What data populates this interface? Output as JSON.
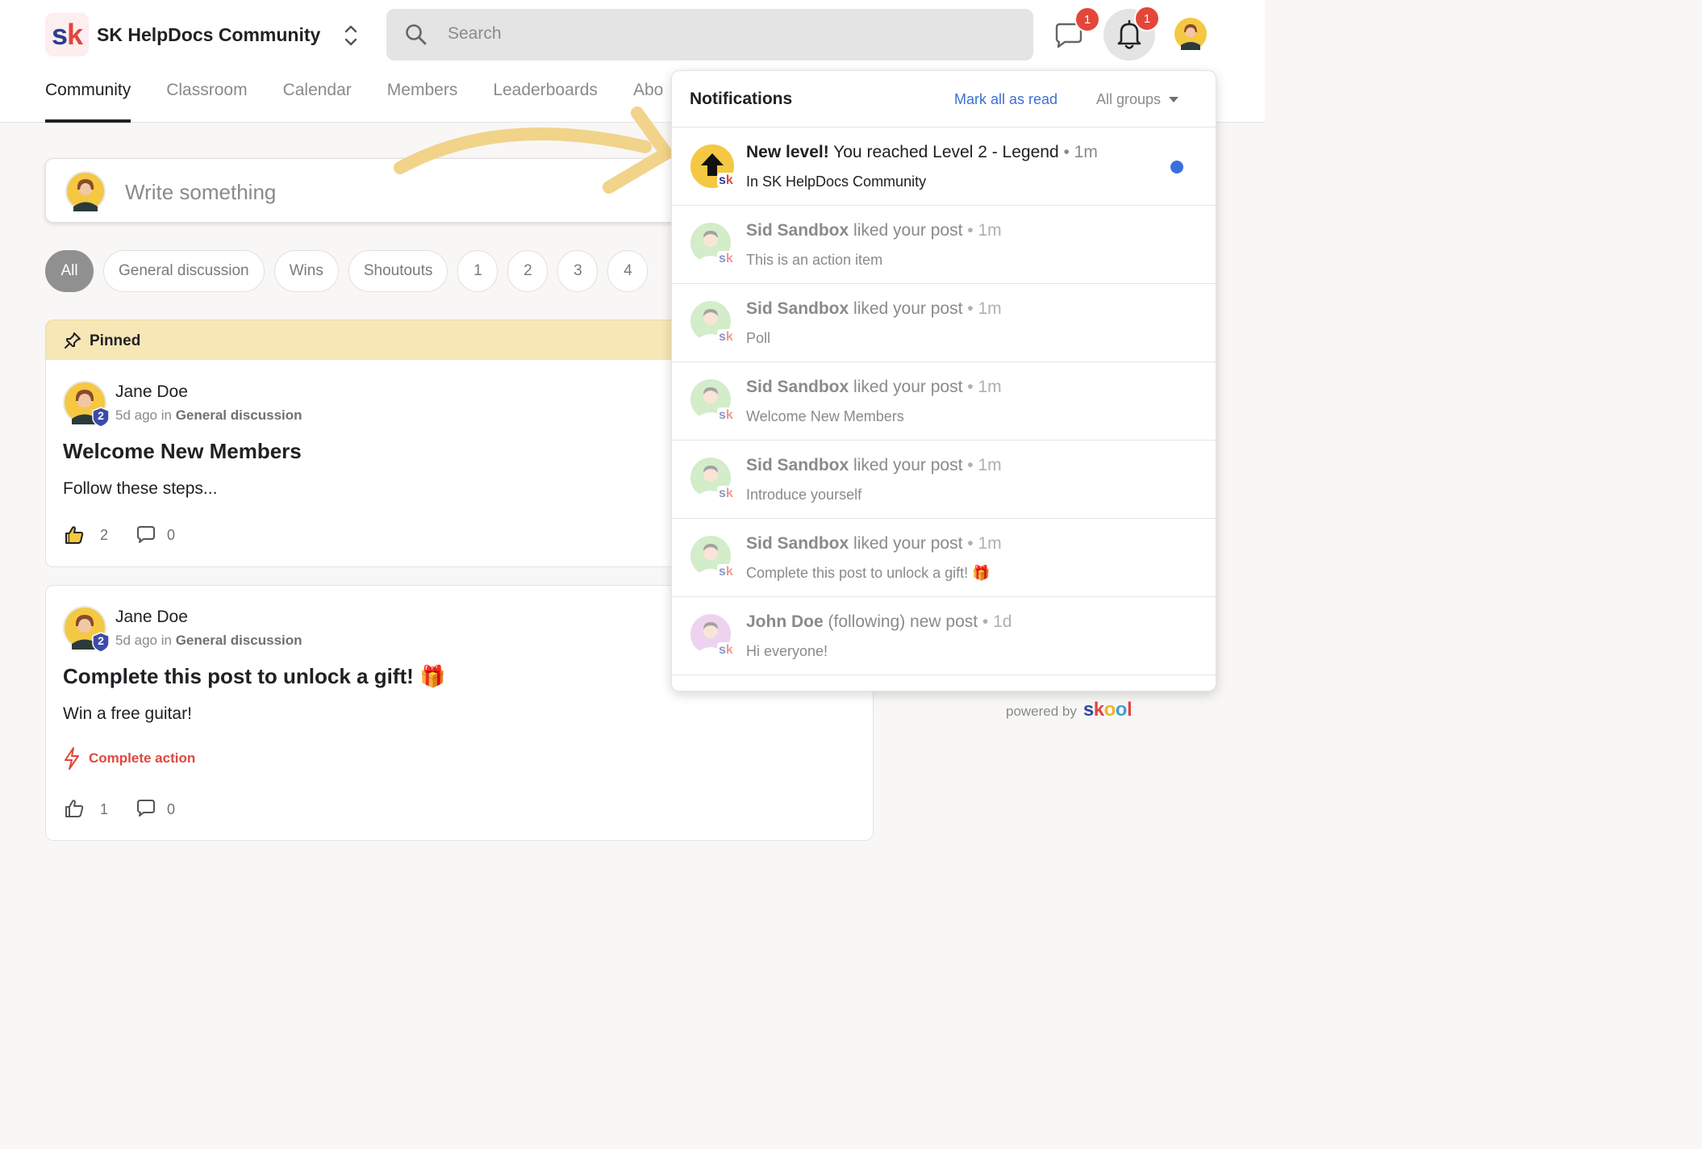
{
  "header": {
    "logo_text_s": "s",
    "logo_text_k": "k",
    "group_name": "SK HelpDocs Community",
    "search_placeholder": "Search",
    "chat_badge": "1",
    "bell_badge": "1"
  },
  "tabs": [
    {
      "label": "Community",
      "active": true
    },
    {
      "label": "Classroom"
    },
    {
      "label": "Calendar"
    },
    {
      "label": "Members"
    },
    {
      "label": "Leaderboards"
    },
    {
      "label": "Abo"
    }
  ],
  "composer": {
    "placeholder": "Write something"
  },
  "filters": [
    "All",
    "General discussion",
    "Wins",
    "Shoutouts",
    "1",
    "2",
    "3",
    "4"
  ],
  "pinned": {
    "label": "Pinned"
  },
  "posts": [
    {
      "author": "Jane Doe",
      "level": "2",
      "meta_prefix": "5d ago in",
      "category": "General discussion",
      "title": "Welcome New Members",
      "body": "Follow these steps...",
      "likes": "2",
      "comments": "0"
    },
    {
      "author": "Jane Doe",
      "level": "2",
      "meta_prefix": "5d ago in",
      "category": "General discussion",
      "title": "Complete this post to unlock a gift! 🎁",
      "body": "Win a free guitar!",
      "action": "Complete action",
      "likes": "1",
      "comments": "0"
    }
  ],
  "powered_by": {
    "label": "powered by",
    "brand": [
      "s",
      "k",
      "o",
      "o",
      "l"
    ]
  },
  "notifications": {
    "title": "Notifications",
    "mark_all": "Mark all as read",
    "groups": "All groups",
    "items": [
      {
        "strong": "New level!",
        "rest": " You reached Level 2 - Legend",
        "time": " • 1m",
        "sub": "In SK HelpDocs Community",
        "unread": true
      },
      {
        "strong": "Sid Sandbox",
        "rest": " liked your post",
        "time": " • 1m",
        "sub": "This is an action item"
      },
      {
        "strong": "Sid Sandbox",
        "rest": " liked your post",
        "time": " • 1m",
        "sub": "Poll"
      },
      {
        "strong": "Sid Sandbox",
        "rest": " liked your post",
        "time": " • 1m",
        "sub": "Welcome New Members"
      },
      {
        "strong": "Sid Sandbox",
        "rest": " liked your post",
        "time": " • 1m",
        "sub": "Introduce yourself"
      },
      {
        "strong": "Sid Sandbox",
        "rest": " liked your post",
        "time": " • 1m",
        "sub": "Complete this post to unlock a gift! 🎁"
      },
      {
        "strong": "John Doe",
        "rest": " (following) new post",
        "time": " • 1d",
        "sub": "Hi everyone!"
      }
    ]
  },
  "colors": {
    "accent_blue": "#3b6fd4",
    "badge_red": "#e4463a",
    "pinned_bg": "#f7e7b6",
    "unread_dot": "#3b6fe0",
    "arrow": "#f1d38a"
  },
  "icons": [
    "search-icon",
    "chat-icon",
    "bell-icon",
    "pin-icon",
    "thumbs-up-icon",
    "comment-icon",
    "lightning-icon",
    "level-up-arrow-icon",
    "chevron-updown-icon"
  ]
}
